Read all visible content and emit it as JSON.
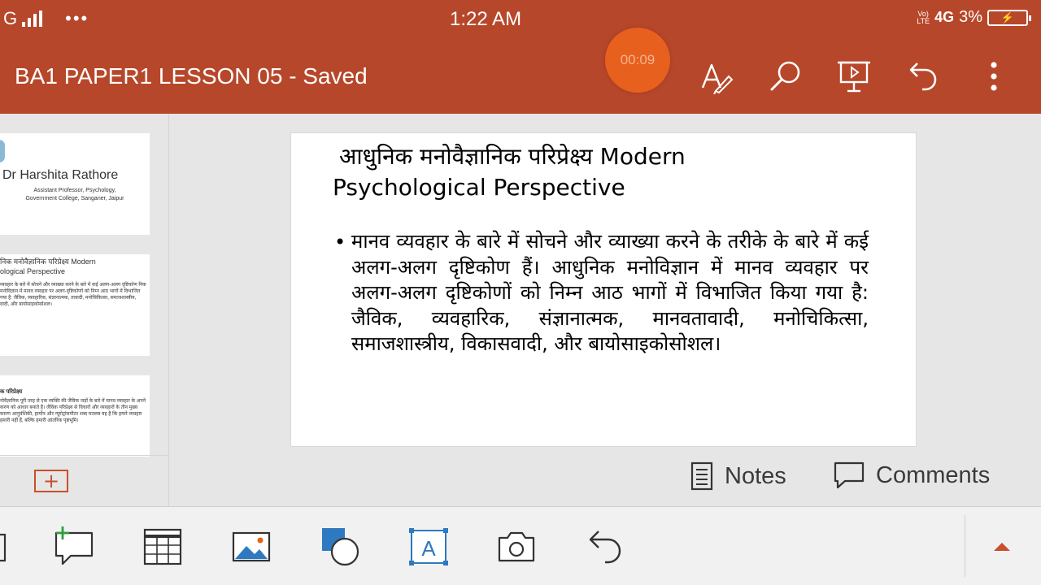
{
  "status_bar": {
    "network": "G",
    "more": "•••",
    "time": "1:22 AM",
    "volte_line1": "Vo)",
    "volte_line2": "LTE",
    "network_type": "4G",
    "battery_percent": "3%"
  },
  "title_bar": {
    "document_title": "BA1 PAPER1 LESSON 05 - Saved",
    "timer": "00:09",
    "icons": [
      "draw-pen-icon",
      "search-icon",
      "present-slideshow-icon",
      "undo-icon",
      "more-options-icon"
    ]
  },
  "thumbnails": [
    {
      "name": "Dr Harshita Rathore",
      "subtitle_line1": "Assistant Professor, Psychology,",
      "subtitle_line2": "Government College, Sanganer, Jaipur"
    },
    {
      "title_line1": "निक मनोवैज्ञानिक परिप्रेक्ष्य Modern",
      "title_line2": "ological Perspective",
      "body": "व्यवहार के बारे में सोचने और व्याख्या करने के बारे में कई अलग-अलग दृष्टिकोण निक मनोविज्ञान में मानव व्यवहार पर अलग-दृष्टिकोणों को निम्न आठ भागों में विभाजित गया है: जैविक, व्यवहारिक, संज्ञानात्मक, तावादी, मनोचिकित्सा, समाजशास्त्रीय, वादी, और बायोसाइकोसोशल।"
    },
    {
      "title": "क परिप्रेक्ष्य",
      "body": "नोवैज्ञानिक पूरी तरह से एक व्यक्ति की जैविक जड़ों के बारे में मानव व्यवहार के अपने करण को आधार बनाते हैं। जैविक परिप्रेक्ष्य से विचारों और व्यवहारों के तीन मुख्य कारण आनुवंशिकी, हार्मोन और न्यूरोट्रांसमीटर शब्द मतलब यह है कि हमारे व्यवहार हमारी नहीं हैं, बल्कि हमारी आंतरिक पृष्ठभूमि।"
    }
  ],
  "slide": {
    "title_line1": "आधुनिक मनोवैज्ञानिक परिप्रेक्ष्य Modern",
    "title_line2": "Psychological Perspective",
    "bullet": "•",
    "body": "मानव व्यवहार के बारे में सोचने और व्याख्या करने के तरीके के बारे में कई अलग-अलग दृष्टिकोण हैं। आधुनिक मनोविज्ञान में मानव व्यवहार पर अलग-अलग दृष्टिकोणों को निम्न आठ भागों में विभाजित किया गया है: जैविक, व्यवहारिक, संज्ञानात्मक, मानवतावादी, मनोचिकित्सा, समाजशास्त्रीय, विकासवादी, और बायोसाइकोसोशल।"
  },
  "notes_label": "Notes",
  "comments_label": "Comments",
  "add_slide_symbol": "+",
  "bottom_toolbar": [
    "new-comment-icon",
    "insert-table-icon",
    "insert-picture-icon",
    "insert-shape-icon",
    "insert-textbox-icon",
    "camera-icon",
    "undo-icon",
    "expand-arrow-icon"
  ],
  "colors": {
    "brand": "#b7472a",
    "accent": "#c8502c",
    "timer": "#e8601e",
    "comment_plus": "#2e9d3e",
    "textbox_blue": "#2f79c0"
  }
}
